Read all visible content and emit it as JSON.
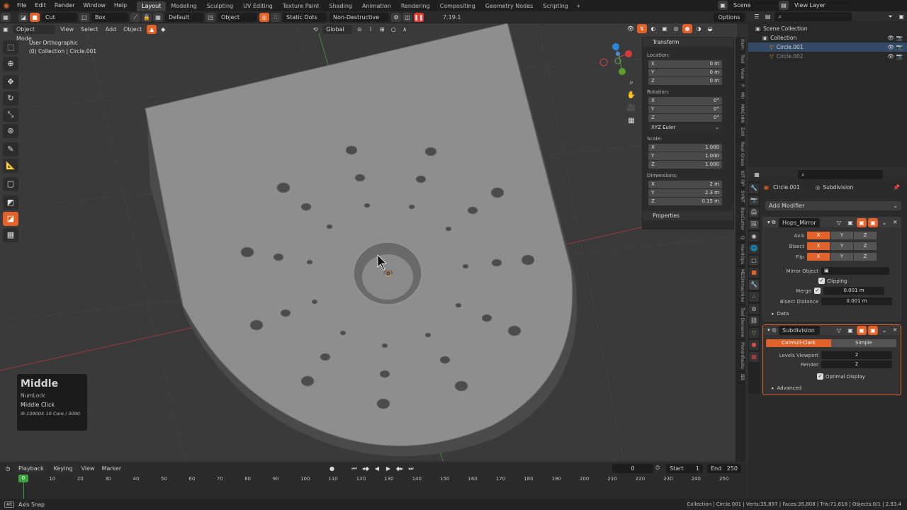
{
  "top_menu": [
    "File",
    "Edit",
    "Render",
    "Window",
    "Help"
  ],
  "workspace_tabs": [
    "Layout",
    "Modeling",
    "Sculpting",
    "UV Editing",
    "Texture Paint",
    "Shading",
    "Animation",
    "Rendering",
    "Compositing",
    "Geometry Nodes",
    "Scripting"
  ],
  "active_workspace": "Layout",
  "scene": {
    "label": "Scene",
    "view_layer": "View Layer"
  },
  "tool_header": {
    "cut": "Cut",
    "box": "Box",
    "default": "Default",
    "object": "Object",
    "static_dots": "Static Dots",
    "non_destructive": "Non-Destructive",
    "version": "7.19.1",
    "options": "Options"
  },
  "viewport_header": {
    "mode": "Object Mode",
    "menus": [
      "View",
      "Select",
      "Add",
      "Object"
    ],
    "orientation": "Global"
  },
  "viewport": {
    "view_name": "User Orthographic",
    "collection_path": "(0) Collection | Circle.001"
  },
  "npanel": {
    "transform_title": "Transform",
    "location_label": "Location:",
    "location": [
      [
        "X",
        "0 m"
      ],
      [
        "Y",
        "0 m"
      ],
      [
        "Z",
        "0 m"
      ]
    ],
    "rotation_label": "Rotation:",
    "rotation": [
      [
        "X",
        "0°"
      ],
      [
        "Y",
        "0°"
      ],
      [
        "Z",
        "0°"
      ]
    ],
    "rotation_mode": "XYZ Euler",
    "scale_label": "Scale:",
    "scale": [
      [
        "X",
        "1.000"
      ],
      [
        "Y",
        "1.000"
      ],
      [
        "Z",
        "1.000"
      ]
    ],
    "dimensions_label": "Dimensions:",
    "dimensions": [
      [
        "X",
        "2 m"
      ],
      [
        "Y",
        "2.3 m"
      ],
      [
        "Z",
        "0.15 m"
      ]
    ],
    "properties_title": "Properties"
  },
  "side_tabs": [
    "Item",
    "Tool",
    "View",
    "P",
    "Mir",
    "MACHIN",
    "Edit",
    "Real Grass",
    "KIT OP",
    "SYNT",
    "BoxCutter",
    "Q",
    "HardOps",
    "MESHmachine",
    "Tool Deneme",
    "PistonRadio",
    "BB"
  ],
  "outliner": {
    "rows": [
      {
        "label": "Scene Collection",
        "indent": 0
      },
      {
        "label": "Collection",
        "indent": 1
      },
      {
        "label": "Circle.001",
        "indent": 2
      },
      {
        "label": "Circle.002",
        "indent": 2
      }
    ]
  },
  "properties": {
    "object_name": "Circle.001",
    "modifier_name_header": "Subdivision",
    "add_modifier": "Add Modifier",
    "mirror": {
      "name": "Hops_Mirror",
      "axis_label": "Axis",
      "bisect_label": "Bisect",
      "flip_label": "Flip",
      "axes": [
        "X",
        "Y",
        "Z"
      ],
      "mirror_object_label": "Mirror Object",
      "clipping_label": "Clipping",
      "merge_label": "Merge",
      "merge_value": "0.001 m",
      "bisect_distance_label": "Bisect Distance",
      "bisect_distance_value": "0.001 m",
      "data_label": "Data"
    },
    "subdivision": {
      "name": "Subdivision",
      "catmull": "Catmull-Clark",
      "simple": "Simple",
      "levels_viewport_label": "Levels Viewport",
      "levels_viewport": "2",
      "render_label": "Render",
      "render": "2",
      "optimal_display": "Optimal Display",
      "advanced": "Advanced"
    }
  },
  "timeline": {
    "menus": [
      "Playback",
      "Keying",
      "View",
      "Marker"
    ],
    "current_frame": "0",
    "start_label": "Start",
    "start": "1",
    "end_label": "End",
    "end": "250",
    "ticks": [
      "0",
      "10",
      "20",
      "30",
      "40",
      "50",
      "60",
      "70",
      "80",
      "90",
      "100",
      "110",
      "120",
      "130",
      "140",
      "150",
      "160",
      "170",
      "180",
      "190",
      "200",
      "210",
      "220",
      "230",
      "240",
      "250"
    ]
  },
  "key_overlay": {
    "key": "Middle",
    "modifier": "NumLock",
    "action": "Middle Click",
    "info": "i9-10900X 10 Core / 3090"
  },
  "statusbar": {
    "left": "Axis Snap",
    "right": "Collection | Circle.001 | Verts:35,897 | Faces:35,808 | Tris:71,616 | Objects:0/1 | 2.93.4"
  },
  "colors": {
    "accent": "#e2622a",
    "bg": "#303030",
    "panel": "#2b2b2b"
  }
}
